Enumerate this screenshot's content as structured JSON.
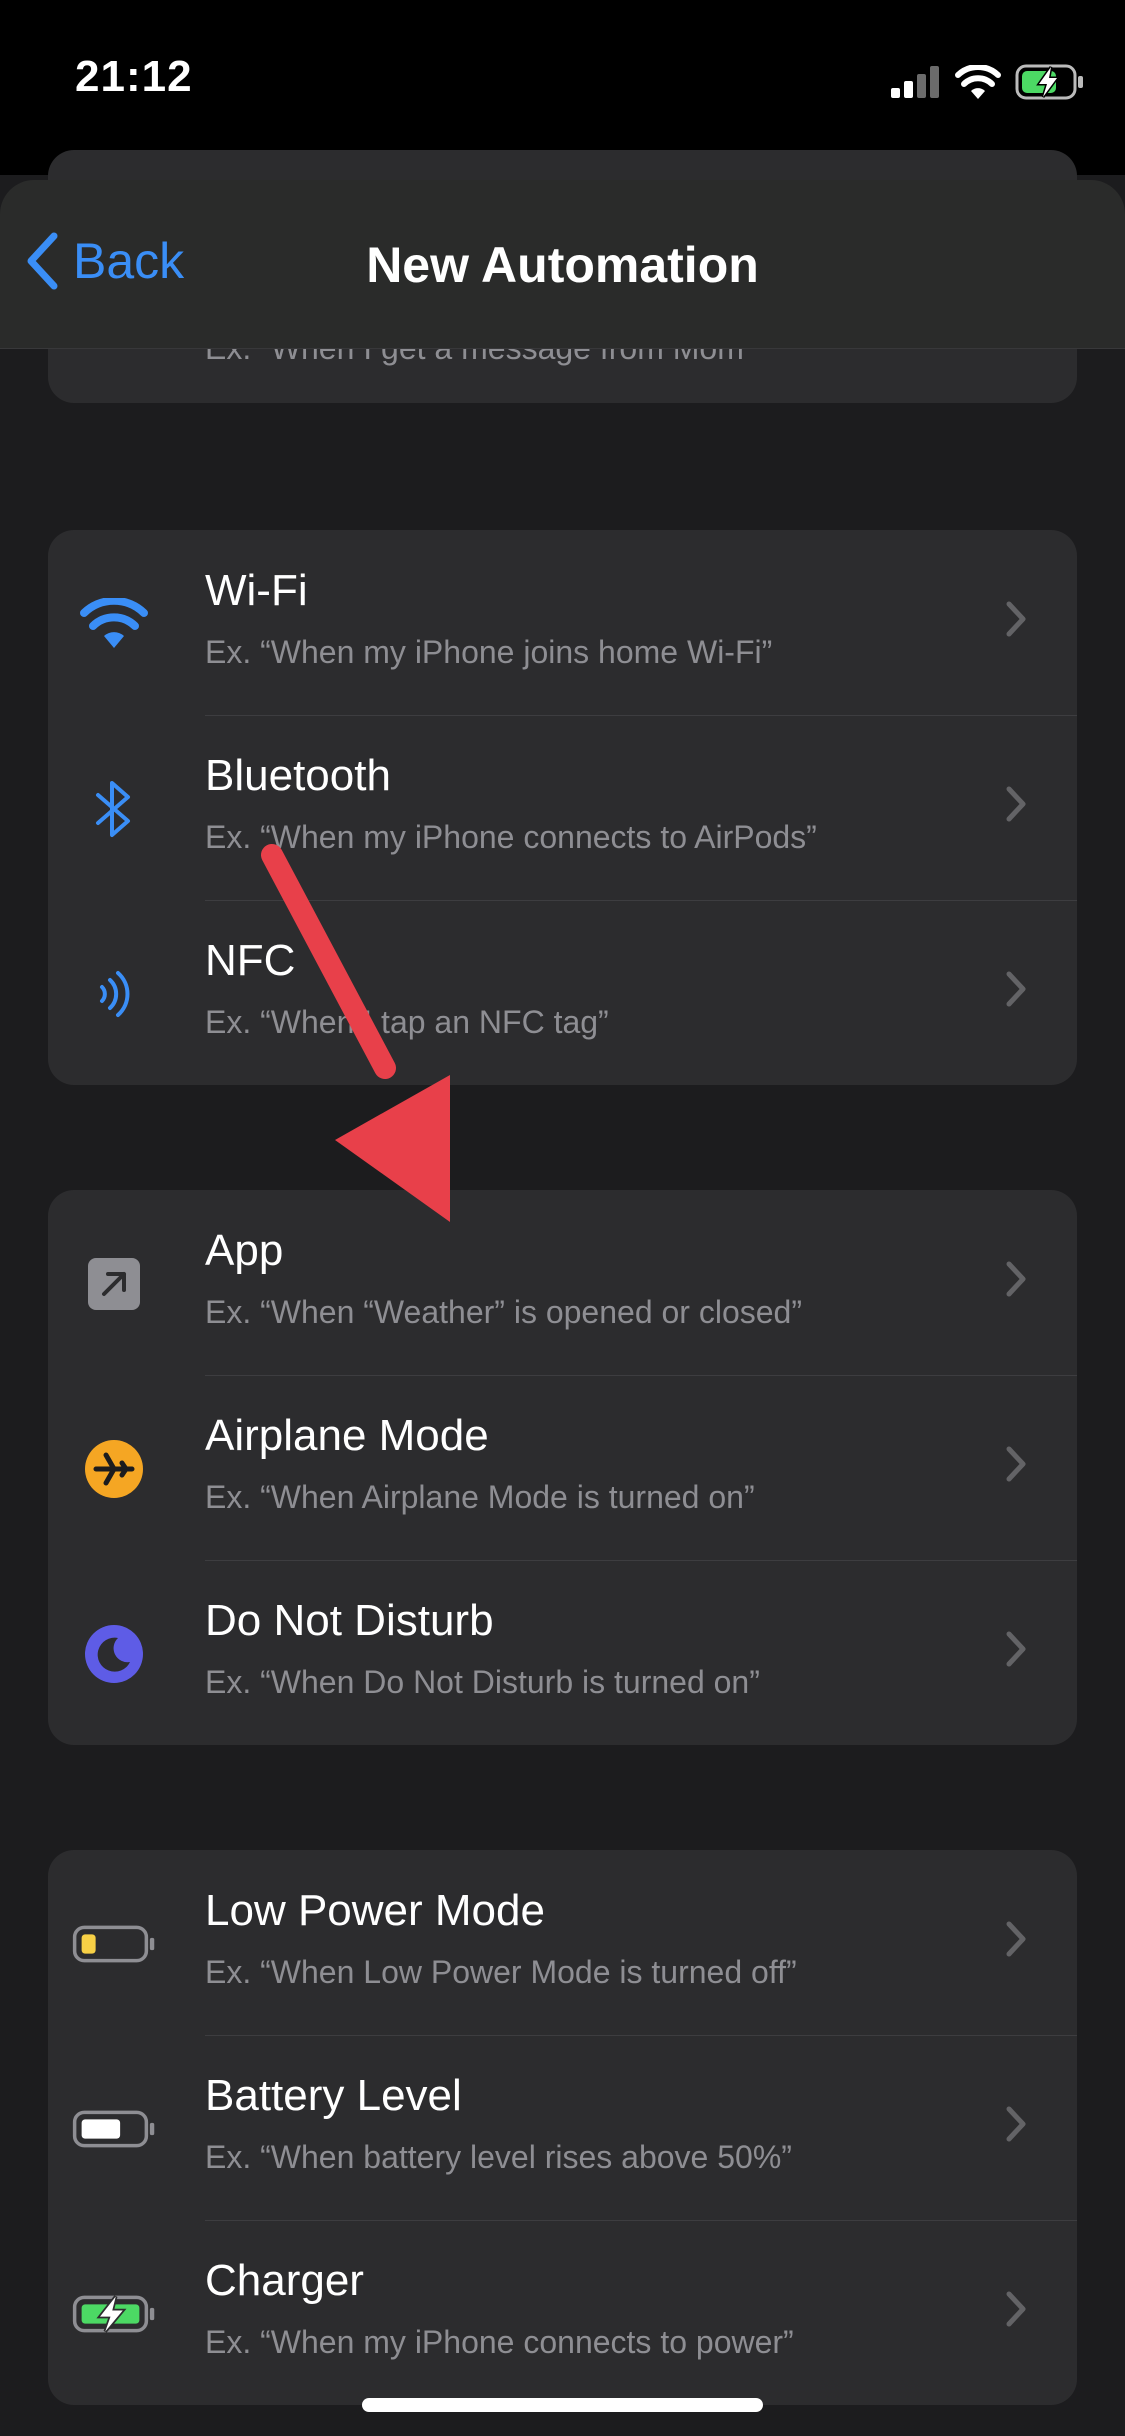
{
  "status": {
    "time": "21:12"
  },
  "nav": {
    "back_label": "Back",
    "title": "New Automation"
  },
  "partial_row": {
    "subtitle": "Ex. “When I get a message from Mom”"
  },
  "groups": [
    {
      "rows": [
        {
          "title": "Wi-Fi",
          "subtitle": "Ex. “When my iPhone joins home Wi-Fi”",
          "icon": "wifi-icon"
        },
        {
          "title": "Bluetooth",
          "subtitle": "Ex. “When my iPhone connects to AirPods”",
          "icon": "bluetooth-icon"
        },
        {
          "title": "NFC",
          "subtitle": "Ex. “When I tap an NFC tag”",
          "icon": "nfc-icon"
        }
      ]
    },
    {
      "rows": [
        {
          "title": "App",
          "subtitle": "Ex. “When “Weather” is opened or closed”",
          "icon": "app-icon"
        },
        {
          "title": "Airplane Mode",
          "subtitle": "Ex. “When Airplane Mode is turned on”",
          "icon": "airplane-icon"
        },
        {
          "title": "Do Not Disturb",
          "subtitle": "Ex. “When Do Not Disturb is turned on”",
          "icon": "moon-icon"
        }
      ]
    },
    {
      "rows": [
        {
          "title": "Low Power Mode",
          "subtitle": "Ex. “When Low Power Mode is turned off”",
          "icon": "low-battery-icon"
        },
        {
          "title": "Battery Level",
          "subtitle": "Ex. “When battery level rises above 50%”",
          "icon": "battery-icon"
        },
        {
          "title": "Charger",
          "subtitle": "Ex. “When my iPhone connects to power”",
          "icon": "charging-battery-icon"
        }
      ]
    }
  ],
  "colors": {
    "accent": "#3a8ef6",
    "airplane": "#f5a623",
    "dnd": "#5e5ce6",
    "annotation_arrow": "#e8404a",
    "charge": "#4cd964",
    "low_power": "#f7d046"
  }
}
